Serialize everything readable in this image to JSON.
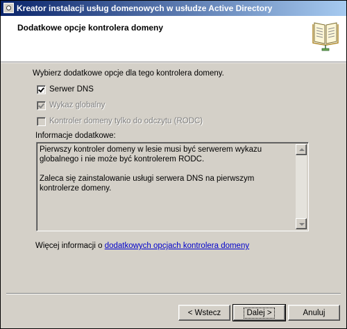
{
  "window": {
    "title": "Kreator instalacji usług domenowych w usłudze Active Directory"
  },
  "header": {
    "title": "Dodatkowe opcje kontrolera domeny",
    "icon": "book-icon"
  },
  "intro": "Wybierz dodatkowe opcje dla tego kontrolera domeny.",
  "options": [
    {
      "label": "Serwer DNS",
      "checked": true,
      "enabled": true
    },
    {
      "label": "Wykaz globalny",
      "checked": true,
      "enabled": false
    },
    {
      "label": "Kontroler domeny tylko do odczytu (RODC)",
      "checked": false,
      "enabled": false
    }
  ],
  "info": {
    "label": "Informacje dodatkowe:",
    "text": "Pierwszy kontroler domeny w lesie musi być serwerem wykazu globalnego i nie może być kontrolerem RODC.\n\nZaleca się zainstalowanie usługi serwera DNS na pierwszym kontrolerze domeny."
  },
  "more_info": {
    "prefix": "Więcej informacji o ",
    "link": "dodatkowych opcjach kontrolera domeny"
  },
  "buttons": {
    "back": "< Wstecz",
    "next": "Dalej >",
    "cancel": "Anuluj"
  }
}
